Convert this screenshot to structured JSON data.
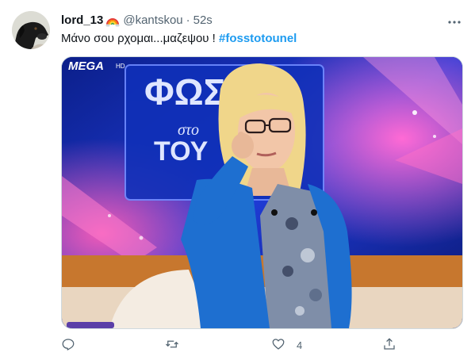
{
  "tweet": {
    "display_name": "lord_13",
    "handle": "@kantskou",
    "separator": "·",
    "time": "52s",
    "text": "Μάνο σου ρχομαι...μαζεψου ! ",
    "hashtag": "#fosstotounel",
    "media": {
      "logo_text": "MEGA",
      "logo_suffix": "HD",
      "sign_top": "ΦΩΣ",
      "sign_mid": "στο",
      "sign_bottom": "ΤΟΥ"
    },
    "actions": {
      "like_count": "4"
    }
  },
  "colors": {
    "accent": "#1d9bf0",
    "secondary_text": "#536471",
    "studio_blue": "#0a2a9a",
    "jacket_blue": "#1e6fd0"
  },
  "icons": [
    "avatar-dog",
    "rainbow-icon",
    "more-icon",
    "reply-icon",
    "retweet-icon",
    "like-icon",
    "share-icon"
  ]
}
